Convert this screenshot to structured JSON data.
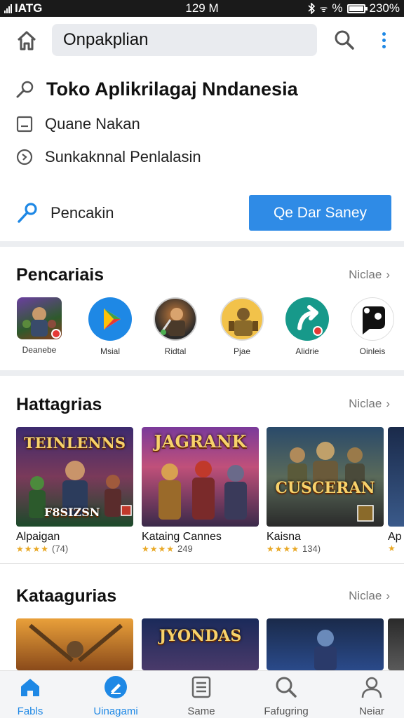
{
  "status_bar": {
    "carrier": "IATG",
    "center": "129 M",
    "signal_pct": "%",
    "battery": "230%"
  },
  "app_bar": {
    "search_value": "Onpakplian",
    "home_icon": "home-icon",
    "search_icon": "search-icon",
    "more_icon": "more-vertical-icon"
  },
  "info": {
    "title": "Toko Aplikrilagaj Nndanesia",
    "line1": "Quane Nakan",
    "line2": "Sunkaknnal Penlalasin",
    "link_label": "Pencakin",
    "cta_label": "Qe Dar Saney"
  },
  "sections": {
    "s1": {
      "title": "Pencariais",
      "more": "Niclae"
    },
    "s2": {
      "title": "Hattagrias",
      "more": "Niclae"
    },
    "s3": {
      "title": "Kataagurias",
      "more": "Niclae"
    }
  },
  "apps": [
    {
      "label": "Deanebe",
      "icon": "game-thumb-icon"
    },
    {
      "label": "Msial",
      "icon": "play-store-icon"
    },
    {
      "label": "Ridtal",
      "icon": "warrior-icon"
    },
    {
      "label": "Pjae",
      "icon": "golden-warrior-icon"
    },
    {
      "label": "Alidrie",
      "icon": "teal-arrow-icon"
    },
    {
      "label": "Oinleis",
      "icon": "black-chat-icon"
    }
  ],
  "cards_row1": [
    {
      "name": "Alpaigan",
      "art_title": "TEINLENNS",
      "art_sub": "F8SIZSN",
      "stars": "★★★★",
      "count": "(74)"
    },
    {
      "name": "Kataing Cannes",
      "art_title": "JAGRANK",
      "art_sub": "",
      "stars": "★★★★",
      "count": "249"
    },
    {
      "name": "Kaisna",
      "art_title": "CUSCERAN",
      "art_sub": "",
      "stars": "★★★★",
      "count": "134)"
    },
    {
      "name": "Ap",
      "art_title": "",
      "art_sub": "",
      "stars": "★",
      "count": ""
    }
  ],
  "cards_row2": [
    {
      "art_title": ""
    },
    {
      "art_title": "JYONDAS"
    },
    {
      "art_title": ""
    },
    {
      "art_title": ""
    }
  ],
  "bottom_nav": [
    {
      "label": "Fabls",
      "icon": "home-icon",
      "active": true
    },
    {
      "label": "Uinagami",
      "icon": "apps-icon",
      "active": true
    },
    {
      "label": "Same",
      "icon": "list-icon",
      "active": false
    },
    {
      "label": "Fafugring",
      "icon": "search-icon",
      "active": false
    },
    {
      "label": "Neiar",
      "icon": "person-icon",
      "active": false
    }
  ],
  "colors": {
    "accent": "#1e88e5",
    "cta": "#2f8be6",
    "status_bar": "#1a1a1a",
    "search_bg": "#e9ebef"
  }
}
